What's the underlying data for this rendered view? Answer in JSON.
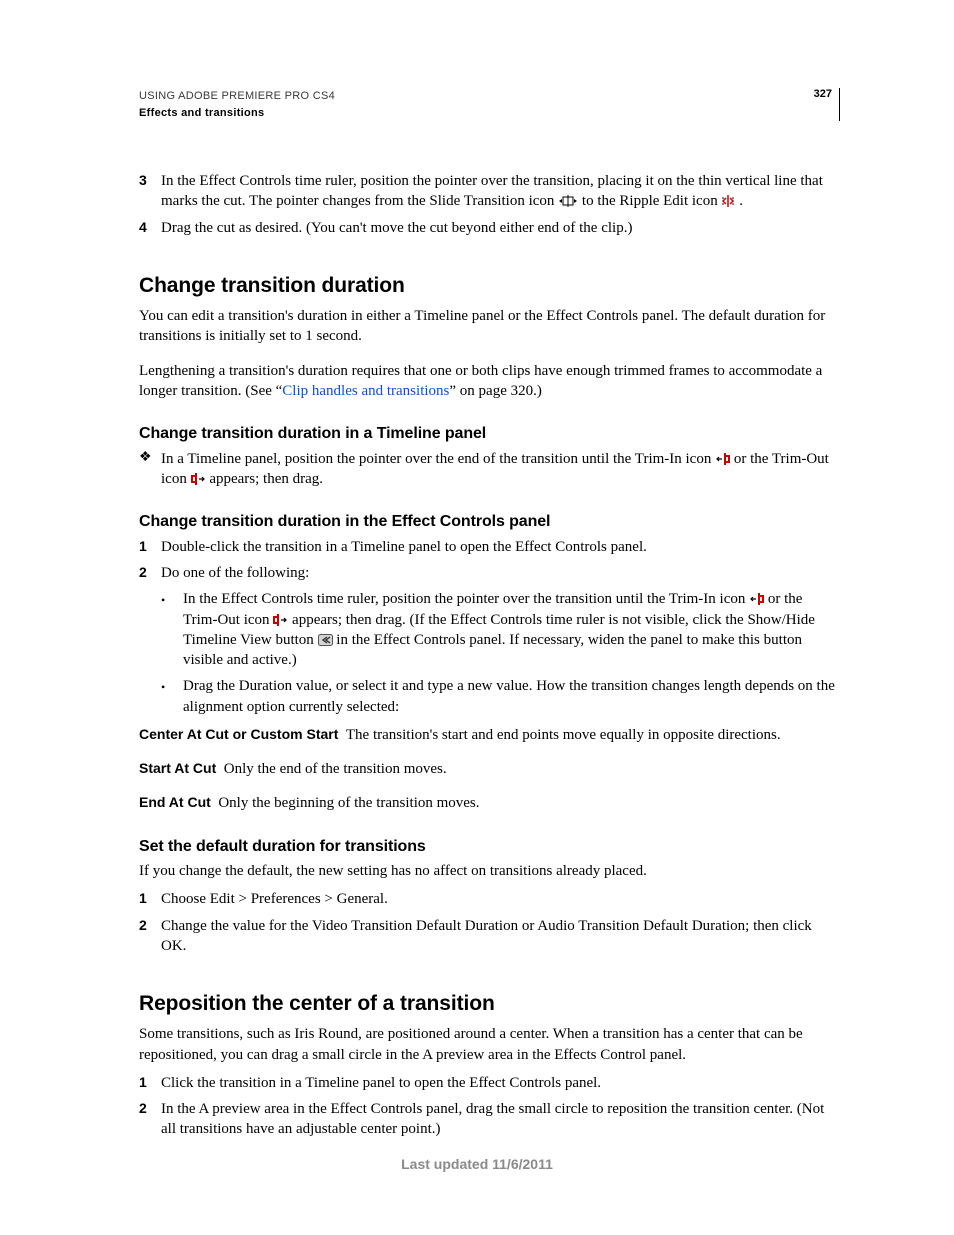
{
  "header": {
    "line1": "USING ADOBE PREMIERE PRO CS4",
    "line2": "Effects and transitions",
    "page_number": "327"
  },
  "top_steps": {
    "s3": {
      "num": "3",
      "text_a": "In the Effect Controls time ruler, position the pointer over the transition, placing it on the thin vertical line that marks the cut. The pointer changes from the Slide Transition icon ",
      "text_b": " to the Ripple Edit icon ",
      "text_c": "."
    },
    "s4": {
      "num": "4",
      "text": "Drag the cut as desired. (You can't move the cut beyond either end of the clip.)"
    }
  },
  "change_duration": {
    "heading": "Change transition duration",
    "p1": "You can edit a transition's duration in either a Timeline panel or the Effect Controls panel. The default duration for transitions is initially set to 1 second.",
    "p2a": "Lengthening a transition's duration requires that one or both clips have enough trimmed frames to accommodate a longer transition. (See “",
    "p2link": "Clip handles and transitions",
    "p2b": "” on page 320.)",
    "timeline": {
      "heading": "Change transition duration in a Timeline panel",
      "bullet_a": "In a Timeline panel, position the pointer over the end of the transition until the Trim-In icon ",
      "bullet_b": " or the Trim-Out icon ",
      "bullet_c": " appears; then drag."
    },
    "effect_controls": {
      "heading": "Change transition duration in the Effect Controls panel",
      "s1": {
        "num": "1",
        "text": "Double-click the transition in a Timeline panel to open the Effect Controls panel."
      },
      "s2": {
        "num": "2",
        "text": "Do one of the following:"
      },
      "b1a": "In the Effect Controls time ruler, position the pointer over the transition until the Trim-In icon ",
      "b1b": " or the Trim-Out icon ",
      "b1c": " appears; then drag. (If the Effect Controls time ruler is not visible, click the Show/Hide Timeline View button ",
      "b1d": " in the Effect Controls panel. If necessary, widen the panel to make this button visible and active.)",
      "b2": "Drag the Duration value, or select it and type a new value. How the transition changes length depends on the alignment option currently selected:",
      "opt1_label": "Center At Cut or Custom Start",
      "opt1_text": "The transition's start and end points move equally in opposite directions.",
      "opt2_label": "Start At Cut",
      "opt2_text": "Only the end of the transition moves.",
      "opt3_label": "End At Cut",
      "opt3_text": "Only the beginning of the transition moves."
    },
    "default": {
      "heading": "Set the default duration for transitions",
      "p": "If you change the default, the new setting has no affect on transitions already placed.",
      "s1": {
        "num": "1",
        "text": "Choose Edit > Preferences > General."
      },
      "s2": {
        "num": "2",
        "text": "Change the value for the Video Transition Default Duration or Audio Transition Default Duration; then click OK."
      }
    }
  },
  "reposition": {
    "heading": "Reposition the center of a transition",
    "p": "Some transitions, such as Iris Round, are positioned around a center. When a transition has a center that can be repositioned, you can drag a small circle in the A preview area in the Effects Control panel.",
    "s1": {
      "num": "1",
      "text": "Click the transition in a Timeline panel to open the Effect Controls panel."
    },
    "s2": {
      "num": "2",
      "text": "In the A preview area in the Effect Controls panel, drag the small circle to reposition the transition center. (Not all transitions have an adjustable center point.)"
    }
  },
  "footer": "Last updated 11/6/2011"
}
